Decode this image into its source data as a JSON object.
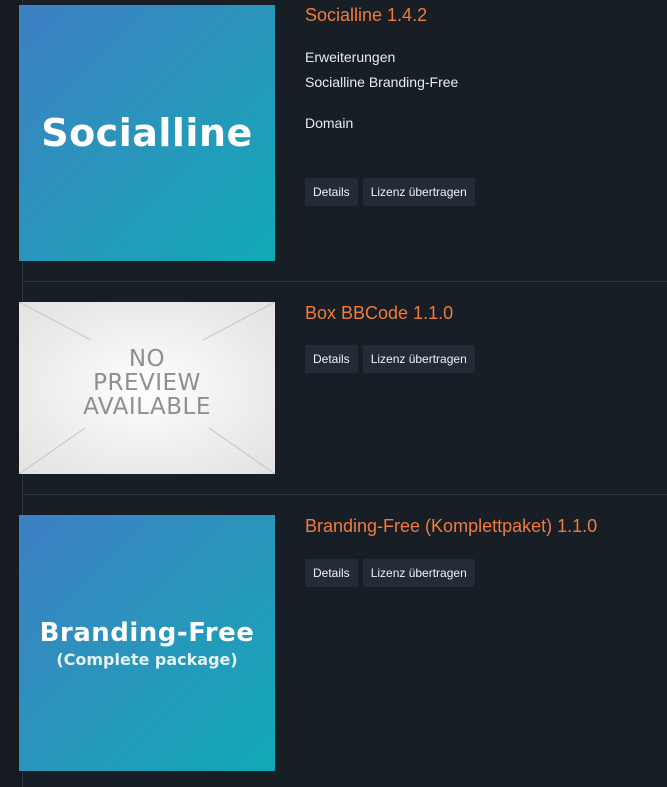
{
  "items": [
    {
      "title": "Socialline 1.4.2",
      "image": {
        "type": "brand",
        "text": "Socialline"
      },
      "meta": [
        "Erweiterungen",
        "Socialline Branding-Free",
        "Domain"
      ],
      "buttons": {
        "details": "Details",
        "transfer": "Lizenz übertragen"
      }
    },
    {
      "title": "Box BBCode 1.1.0",
      "image": {
        "type": "no-preview",
        "lines": [
          "NO",
          "PREVIEW",
          "AVAILABLE"
        ]
      },
      "meta": [],
      "buttons": {
        "details": "Details",
        "transfer": "Lizenz übertragen"
      }
    },
    {
      "title": "Branding-Free (Komplettpaket) 1.1.0",
      "image": {
        "type": "brand",
        "text": "Branding-Free",
        "subtext": "(Complete package)"
      },
      "meta": [],
      "buttons": {
        "details": "Details",
        "transfer": "Lizenz übertragen"
      }
    }
  ],
  "colors": {
    "background": "#181e25",
    "title": "#f07b3b",
    "button_bg": "#232c36",
    "text": "#e8ecef"
  }
}
